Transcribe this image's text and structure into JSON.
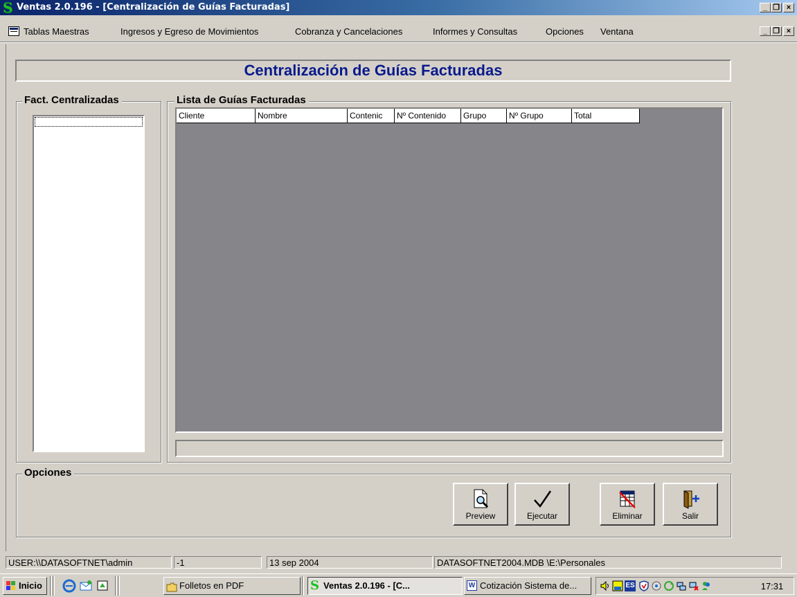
{
  "window": {
    "title": "Ventas 2.0.196 - [Centralización de Guías  Facturadas]",
    "app_icon_glyph": "S",
    "caption_buttons": [
      "minimize",
      "restore",
      "close"
    ]
  },
  "menu": {
    "items": [
      "Tablas Maestras",
      "Ingresos y Egreso de Movimientos",
      "Cobranza y Cancelaciones",
      "Informes y Consultas",
      "Opciones",
      "Ventana"
    ]
  },
  "form": {
    "title": "Centralización de Guías  Facturadas",
    "left_group_label": "Fact. Centralizadas",
    "grid_group_label": "Lista de Guías Facturadas",
    "grid_columns": [
      "Cliente",
      "Nombre",
      "Contenic",
      "Nº Contenido",
      "Grupo",
      "Nº Grupo",
      "Total"
    ],
    "options_group_label": "Opciones",
    "buttons": {
      "preview": "Preview",
      "ejecutar": "Ejecutar",
      "eliminar": "Eliminar",
      "salir": "Salir"
    }
  },
  "statusbar": {
    "user": "USER:\\\\DATASOFTNET\\admin",
    "code": "-1",
    "date": "13 sep 2004",
    "database": "DATASOFTNET2004.MDB \\E:\\Personales"
  },
  "taskbar": {
    "start_label": "Inicio",
    "tasks": [
      "Folletos en PDF",
      "Ventas 2.0.196 - [C...",
      "Cotización Sistema de..."
    ],
    "clock": "17:31",
    "tray_language": "ES"
  },
  "colors": {
    "titlebar_start": "#0a246a",
    "titlebar_end": "#a6caf0",
    "form_title": "#0a1a8c",
    "grid_background": "#868589",
    "face": "#d4d0c8"
  }
}
